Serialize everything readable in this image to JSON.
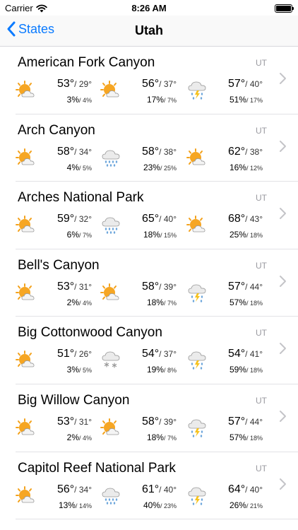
{
  "status": {
    "carrier": "Carrier",
    "time": "8:26 AM"
  },
  "nav": {
    "back_label": "States",
    "title": "Utah"
  },
  "rows": [
    {
      "name": "American Fork Canyon",
      "state": "UT",
      "days": [
        {
          "icon": "sun-cloud-icon",
          "hi": "53°",
          "lo": "/ 29°",
          "pop": "3%",
          "qpf": "/ 4%"
        },
        {
          "icon": "sun-cloud-icon",
          "hi": "56°",
          "lo": "/ 37°",
          "pop": "17%",
          "qpf": "/ 7%"
        },
        {
          "icon": "storm-cloud-icon",
          "hi": "57°",
          "lo": "/ 40°",
          "pop": "51%",
          "qpf": "/ 17%"
        }
      ]
    },
    {
      "name": "Arch Canyon",
      "state": "UT",
      "days": [
        {
          "icon": "sun-cloud-icon",
          "hi": "58°",
          "lo": "/ 34°",
          "pop": "4%",
          "qpf": "/ 5%"
        },
        {
          "icon": "rain-cloud-icon",
          "hi": "58°",
          "lo": "/ 38°",
          "pop": "23%",
          "qpf": "/ 25%"
        },
        {
          "icon": "sun-cloud-icon",
          "hi": "62°",
          "lo": "/ 38°",
          "pop": "16%",
          "qpf": "/ 12%"
        }
      ]
    },
    {
      "name": "Arches National Park",
      "state": "UT",
      "days": [
        {
          "icon": "sun-cloud-icon",
          "hi": "59°",
          "lo": "/ 32°",
          "pop": "6%",
          "qpf": "/ 7%"
        },
        {
          "icon": "rain-cloud-icon",
          "hi": "65°",
          "lo": "/ 40°",
          "pop": "18%",
          "qpf": "/ 15%"
        },
        {
          "icon": "sun-cloud-icon",
          "hi": "68°",
          "lo": "/ 43°",
          "pop": "25%",
          "qpf": "/ 18%"
        }
      ]
    },
    {
      "name": "Bell's Canyon",
      "state": "UT",
      "days": [
        {
          "icon": "sun-cloud-icon",
          "hi": "53°",
          "lo": "/ 31°",
          "pop": "2%",
          "qpf": "/ 4%"
        },
        {
          "icon": "sun-cloud-icon",
          "hi": "58°",
          "lo": "/ 39°",
          "pop": "18%",
          "qpf": "/ 7%"
        },
        {
          "icon": "storm-cloud-icon",
          "hi": "57°",
          "lo": "/ 44°",
          "pop": "57%",
          "qpf": "/ 18%"
        }
      ]
    },
    {
      "name": "Big Cottonwood Canyon",
      "state": "UT",
      "days": [
        {
          "icon": "sun-cloud-icon",
          "hi": "51°",
          "lo": "/ 26°",
          "pop": "3%",
          "qpf": "/ 5%"
        },
        {
          "icon": "snow-cloud-icon",
          "hi": "54°",
          "lo": "/ 37°",
          "pop": "19%",
          "qpf": "/ 8%"
        },
        {
          "icon": "storm-cloud-icon",
          "hi": "54°",
          "lo": "/ 41°",
          "pop": "59%",
          "qpf": "/ 18%"
        }
      ]
    },
    {
      "name": "Big Willow Canyon",
      "state": "UT",
      "days": [
        {
          "icon": "sun-cloud-icon",
          "hi": "53°",
          "lo": "/ 31°",
          "pop": "2%",
          "qpf": "/ 4%"
        },
        {
          "icon": "sun-cloud-icon",
          "hi": "58°",
          "lo": "/ 39°",
          "pop": "18%",
          "qpf": "/ 7%"
        },
        {
          "icon": "storm-cloud-icon",
          "hi": "57°",
          "lo": "/ 44°",
          "pop": "57%",
          "qpf": "/ 18%"
        }
      ]
    },
    {
      "name": "Capitol Reef National Park",
      "state": "UT",
      "days": [
        {
          "icon": "sun-cloud-icon",
          "hi": "56°",
          "lo": "/ 34°",
          "pop": "13%",
          "qpf": "/ 14%"
        },
        {
          "icon": "rain-cloud-icon",
          "hi": "61°",
          "lo": "/ 40°",
          "pop": "40%",
          "qpf": "/ 23%"
        },
        {
          "icon": "storm-cloud-icon",
          "hi": "64°",
          "lo": "/ 40°",
          "pop": "26%",
          "qpf": "/ 21%"
        }
      ]
    }
  ]
}
